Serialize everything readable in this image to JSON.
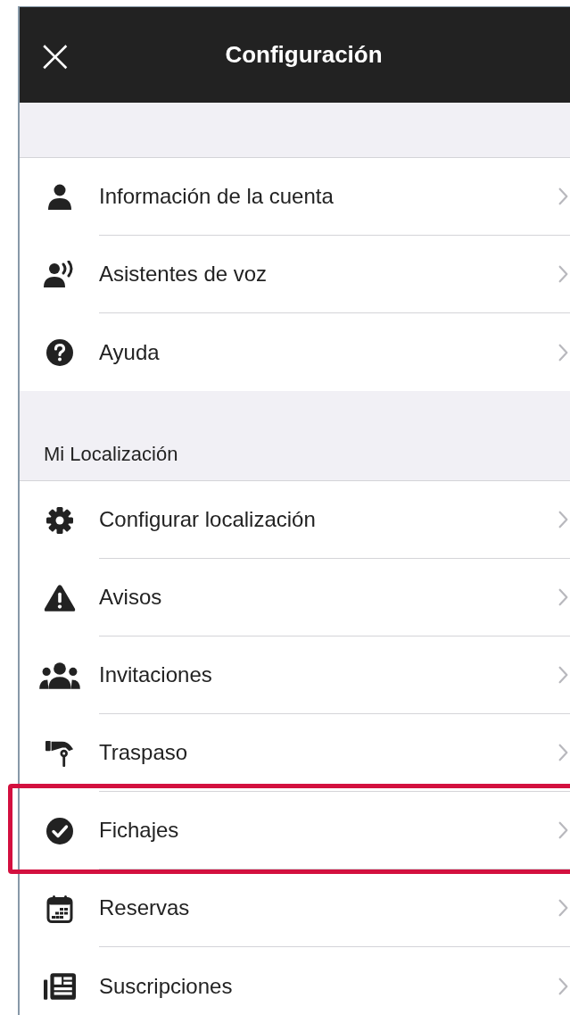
{
  "header": {
    "close": "×",
    "title": "Configuración"
  },
  "sections": [
    {
      "items": [
        {
          "label": "Información de la cuenta",
          "highlighted": false
        },
        {
          "label": "Asistentes de voz",
          "highlighted": false
        },
        {
          "label": "Ayuda",
          "highlighted": false
        }
      ]
    },
    {
      "title": "Mi Localización",
      "items": [
        {
          "label": "Configurar localización",
          "highlighted": false
        },
        {
          "label": "Avisos",
          "highlighted": false
        },
        {
          "label": "Invitaciones",
          "highlighted": false
        },
        {
          "label": "Traspaso",
          "highlighted": false
        },
        {
          "label": "Fichajes",
          "highlighted": true
        },
        {
          "label": "Reservas",
          "highlighted": false
        },
        {
          "label": "Suscripciones",
          "highlighted": false
        }
      ]
    }
  ]
}
